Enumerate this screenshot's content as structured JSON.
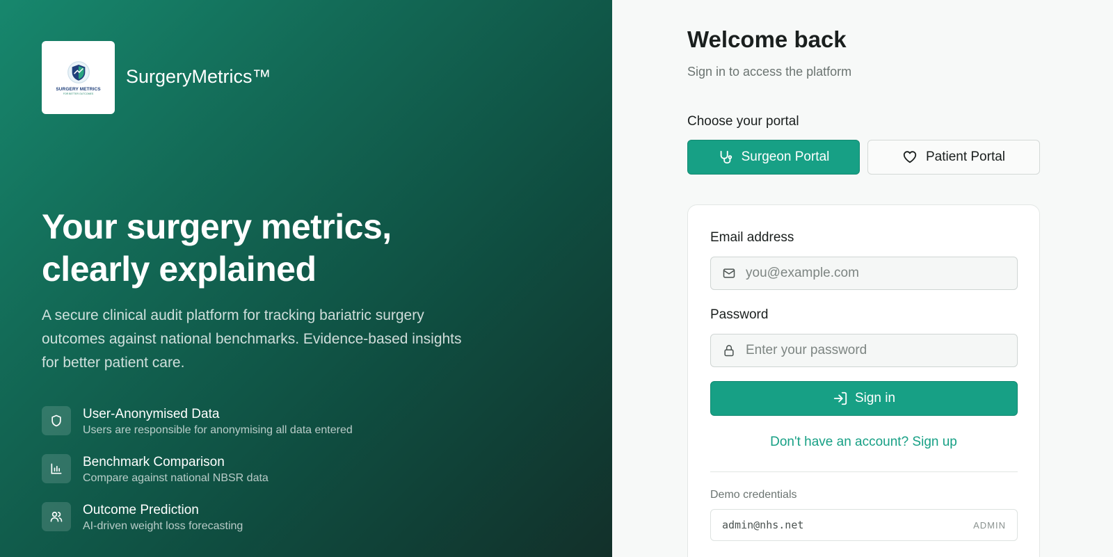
{
  "brand": {
    "name": "SurgeryMetrics™",
    "logo_text": "SURGERY METRICS",
    "logo_subtext": "FOR BETTER OUTCOMES"
  },
  "hero": {
    "headline": "Your surgery metrics, clearly explained",
    "subtitle": "A secure clinical audit platform for tracking bariatric surgery outcomes against national benchmarks. Evidence-based insights for better patient care."
  },
  "features": [
    {
      "icon": "shield-icon",
      "title": "User-Anonymised Data",
      "description": "Users are responsible for anonymising all data entered"
    },
    {
      "icon": "bar-chart-icon",
      "title": "Benchmark Comparison",
      "description": "Compare against national NBSR data"
    },
    {
      "icon": "users-icon",
      "title": "Outcome Prediction",
      "description": "AI-driven weight loss forecasting"
    }
  ],
  "login": {
    "title": "Welcome back",
    "subtitle": "Sign in to access the platform",
    "portal_label": "Choose your portal",
    "portals": [
      {
        "label": "Surgeon Portal",
        "icon": "stethoscope-icon",
        "selected": true
      },
      {
        "label": "Patient Portal",
        "icon": "heart-icon",
        "selected": false
      }
    ],
    "email_label": "Email address",
    "email_placeholder": "you@example.com",
    "email_value": "",
    "password_label": "Password",
    "password_placeholder": "Enter your password",
    "password_value": "",
    "signin_label": "Sign in",
    "signup_text": "Don't have an account? Sign up",
    "demo_label": "Demo credentials",
    "demo_email": "admin@nhs.net",
    "demo_role": "ADMIN"
  },
  "colors": {
    "accent": "#17a085",
    "gradient_start": "#17876d",
    "gradient_end": "#12302a"
  }
}
